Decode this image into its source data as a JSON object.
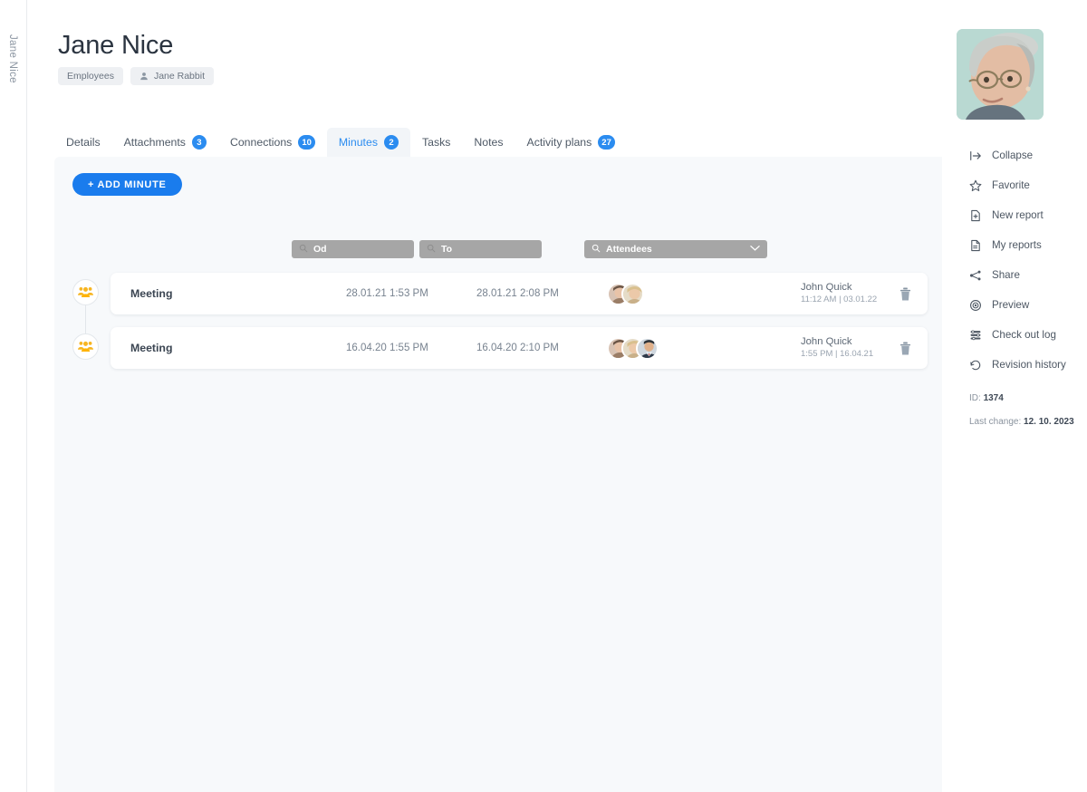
{
  "left_rail": {
    "label": "Jane Nice"
  },
  "header": {
    "title": "Jane Nice",
    "chips": [
      {
        "label": "Employees",
        "icon": ""
      },
      {
        "label": "Jane Rabbit",
        "icon": "person-icon"
      }
    ],
    "close_icon": "close-icon"
  },
  "tabs": [
    {
      "label": "Details",
      "badge": "",
      "active": false
    },
    {
      "label": "Attachments",
      "badge": "3",
      "active": false
    },
    {
      "label": "Connections",
      "badge": "10",
      "active": false
    },
    {
      "label": "Minutes",
      "badge": "2",
      "active": true
    },
    {
      "label": "Tasks",
      "badge": "",
      "active": false
    },
    {
      "label": "Notes",
      "badge": "",
      "active": false
    },
    {
      "label": "Activity plans",
      "badge": "27",
      "active": false
    }
  ],
  "toolbar": {
    "add_minute_label": "+ ADD MINUTE"
  },
  "filters": {
    "from": {
      "value": "Od",
      "icon": "search-icon"
    },
    "to": {
      "value": "To",
      "icon": "search-icon"
    },
    "attendees": {
      "value": "Attendees",
      "icon": "search-icon",
      "chevron": "chevron-down-icon"
    }
  },
  "minutes": [
    {
      "node_icon": "people-group-icon",
      "title": "Meeting",
      "start": "28.01.21 1:53 PM",
      "end": "28.01.21 2:08 PM",
      "attendee_count": 2,
      "author": "John Quick",
      "stamp": "11:12 AM | 03.01.22",
      "delete_icon": "trash-icon"
    },
    {
      "node_icon": "people-group-icon",
      "title": "Meeting",
      "start": "16.04.20 1:55 PM",
      "end": "16.04.20 2:10 PM",
      "attendee_count": 3,
      "author": "John Quick",
      "stamp": "1:55 PM | 16.04.21",
      "delete_icon": "trash-icon"
    }
  ],
  "sidebar": {
    "portrait_alt": "employee-photo",
    "items": [
      {
        "label": "Collapse",
        "icon": "collapse-icon"
      },
      {
        "label": "Favorite",
        "icon": "star-icon"
      },
      {
        "label": "New report",
        "icon": "new-document-icon"
      },
      {
        "label": "My reports",
        "icon": "document-icon"
      },
      {
        "label": "Share",
        "icon": "share-icon"
      },
      {
        "label": "Preview",
        "icon": "eye-icon"
      },
      {
        "label": "Check out log",
        "icon": "checkout-log-icon"
      },
      {
        "label": "Revision history",
        "icon": "history-icon"
      }
    ],
    "meta": {
      "id_label": "ID:",
      "id_value": "1374",
      "last_change_label": "Last change:",
      "last_change_value": "12. 10. 2023"
    }
  },
  "colors": {
    "accent": "#1a7ced",
    "badge": "#2b8cf0",
    "node_icon": "#f7b521",
    "panel_bg": "#f7f9fb"
  }
}
